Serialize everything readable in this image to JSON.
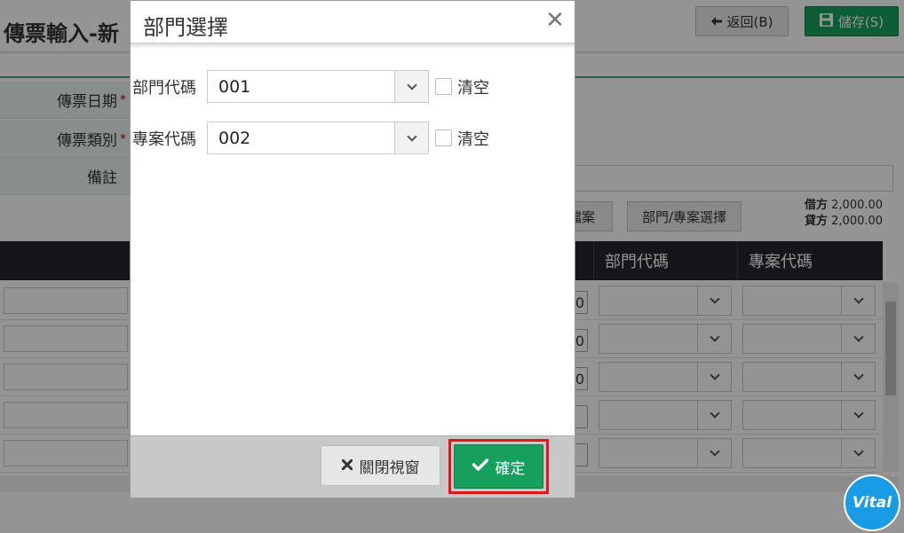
{
  "page": {
    "title": "傳票輸入-新",
    "back_label": "返回(B)",
    "save_label": "儲存(S)",
    "form": {
      "date_label": "傳票日期",
      "type_label": "傳票類別",
      "remark_label": "備註",
      "required_mark": "*"
    },
    "file_button": "檔案",
    "dept_project_button": "部門/專案選擇",
    "totals": {
      "debit_label": "借方",
      "debit_value": "2,000.00",
      "credit_label": "貸方",
      "credit_value": "2,000.00"
    },
    "table": {
      "columns": [
        "部門代碼",
        "專案代碼"
      ],
      "row_amounts": [
        "0",
        "0",
        "0",
        "",
        ""
      ]
    }
  },
  "modal": {
    "title": "部門選擇",
    "close_glyph": "✕",
    "fields": [
      {
        "label": "部門代碼",
        "value": "001",
        "clear_label": "清空"
      },
      {
        "label": "專案代碼",
        "value": "002",
        "clear_label": "清空"
      }
    ],
    "close_button": "關閉視窗",
    "confirm_button": "確定"
  },
  "logo_text": "Vital",
  "colors": {
    "accent_green": "#17a05d",
    "highlight_red": "#e3141b",
    "table_header": "#23272b",
    "logo_blue": "#1a9be6"
  }
}
